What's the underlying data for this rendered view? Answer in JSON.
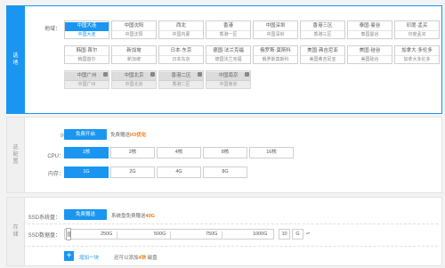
{
  "colors": {
    "accent": "#1a96f0",
    "highlight": "#f07800"
  },
  "sections": {
    "region": "选地",
    "config": "选配置",
    "storage": "存储"
  },
  "region": {
    "label": "地域：",
    "rows": [
      [
        {
          "name": "中国大连",
          "city": "中国大连",
          "selected": true
        },
        {
          "name": "中国沈阳",
          "city": "中国沈阳"
        },
        {
          "name": "西北",
          "city": "中国内蒙"
        },
        {
          "name": "香港",
          "city": "香港一区"
        },
        {
          "name": "中国深圳",
          "city": "中国深圳"
        },
        {
          "name": "香港三区",
          "city": "香港三区"
        },
        {
          "name": "泰国·曼谷",
          "city": "泰国曼谷"
        },
        {
          "name": "印度·孟买",
          "city": "印度孟买"
        }
      ],
      [
        {
          "name": "韩国·首尔",
          "city": "韩国首尔"
        },
        {
          "name": "新加坡",
          "city": "新加坡"
        },
        {
          "name": "日本·东京",
          "city": "日本东京"
        },
        {
          "name": "德国·法兰克福",
          "city": "德国法兰克福"
        },
        {
          "name": "俄罗斯·莫斯科",
          "city": "俄罗斯莫斯科"
        },
        {
          "name": "美国·弗吉尼亚",
          "city": "美国弗吉尼亚"
        },
        {
          "name": "美国·硅谷",
          "city": "美国硅谷"
        },
        {
          "name": "加拿大·多伦多",
          "city": "加拿大多伦多"
        }
      ],
      [
        {
          "name": "中国广州",
          "city": "中国广州",
          "disabled": true
        },
        {
          "name": "中国北京",
          "city": "中国北京",
          "disabled": true
        },
        {
          "name": "香港二区",
          "city": "香港二区",
          "disabled": true
        },
        {
          "name": "中国南京",
          "city": "中国南京",
          "disabled": true
        }
      ]
    ]
  },
  "io": {
    "label": "I/O优化：",
    "button": "免费开启",
    "note_pre": "免费赠送",
    "note_hl": "I/O优化"
  },
  "cpu": {
    "label": "CPU：",
    "options": [
      "1核",
      "2核",
      "4核",
      "8核",
      "16核"
    ],
    "selected": 0
  },
  "memory": {
    "label": "内存：",
    "options": [
      "1G",
      "2G",
      "4G",
      "8G"
    ],
    "selected": 0
  },
  "ssd_system": {
    "label": "SSD系统盘：",
    "button": "免费赠送",
    "note_pre": "系统盘免费赠送",
    "note_hl": "40G"
  },
  "ssd_data": {
    "label": "SSD数据盘：",
    "ticks": [
      "250G",
      "500G",
      "750G",
      "1000G"
    ],
    "value": "10",
    "unit": "G",
    "unit_arrow": "▴▾"
  },
  "add": {
    "plus": "+",
    "label": "增加一块",
    "note_pre": "还可以添加",
    "note_hl": "4块",
    "note_post": "磁盘"
  }
}
